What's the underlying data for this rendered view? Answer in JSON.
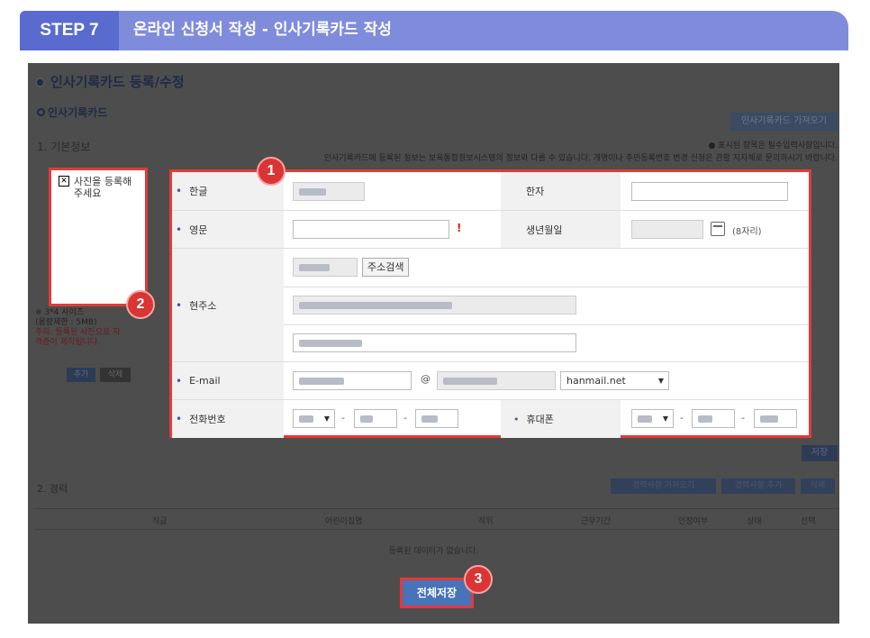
{
  "step": {
    "badge": "STEP 7",
    "title": "온라인 신청서 작성 - 인사기록카드 작성"
  },
  "panel": {
    "title": "인사기록카드 등록/수정",
    "subtitle": "인사기록카드",
    "import_button": "인사기록카드 가져오기",
    "section_basic": "1. 기본정보",
    "notice_required": "● 표시된 항목은 필수입력사항입니다.",
    "notice_info": "인사기록카드에 등록된 정보는 보육통합정보시스템의 정보와 다를 수 있습니다. 개명이나 주민등록번호 변경 신청은 관할 지자체로 문의하시기 바랍니다."
  },
  "photo": {
    "label": "사진을 등록해 주세요",
    "note_lines": [
      "※ 3*4 사이즈",
      "(용량제한 : 5MB)"
    ],
    "note_warn": "주의: 등록된 사진으로 자격증이 제작됩니다.",
    "add_button": "추가",
    "delete_button": "삭제"
  },
  "form": {
    "korean_name_label": "한글",
    "hanja_label": "한자",
    "english_name_label": "영문",
    "required_mark": "!",
    "birth_label": "생년월일",
    "birth_hint": "(8자리)",
    "address_label": "현주소",
    "address_search_button": "주소검색",
    "email_label": "E-mail",
    "email_at": "@",
    "email_domain_selected": "hanmail.net",
    "phone_label": "전화번호",
    "mobile_label": "휴대폰",
    "dash": "-"
  },
  "badges": {
    "one": "1",
    "two": "2",
    "three": "3"
  },
  "lower": {
    "save_button": "저장",
    "section_career": "2. 경력",
    "career_buttons": [
      "경력사항 가져오기",
      "경력사항 추가",
      "삭제"
    ],
    "table_headers": [
      "직급",
      "어린이집명",
      "직위",
      "근무기간",
      "인정여부",
      "상태",
      "선택"
    ],
    "empty_message": "등록된 데이터가 없습니다.",
    "save_all_button": "전체저장"
  },
  "colors": {
    "accent": "#7f8cdc",
    "step_badge": "#5a6bcf",
    "highlight": "#e23a3a",
    "save_all": "#4773b8"
  }
}
